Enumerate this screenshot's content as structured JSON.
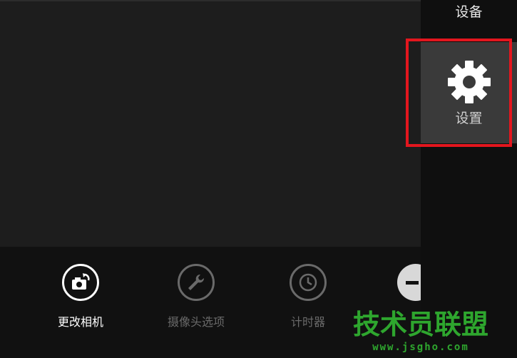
{
  "charm_bar": {
    "header": "设备",
    "settings_label": "设置"
  },
  "app_bar": {
    "buttons": [
      {
        "label": "更改相机",
        "icon": "camera-switch-icon",
        "enabled": true
      },
      {
        "label": "摄像头选项",
        "icon": "wrench-icon",
        "enabled": false
      },
      {
        "label": "计时器",
        "icon": "clock-icon",
        "enabled": false
      }
    ]
  },
  "watermark": {
    "text": "技术员联盟",
    "url": "www.jsgho.com"
  },
  "colors": {
    "highlight": "#e3161e",
    "watermark": "#2ea62e"
  }
}
